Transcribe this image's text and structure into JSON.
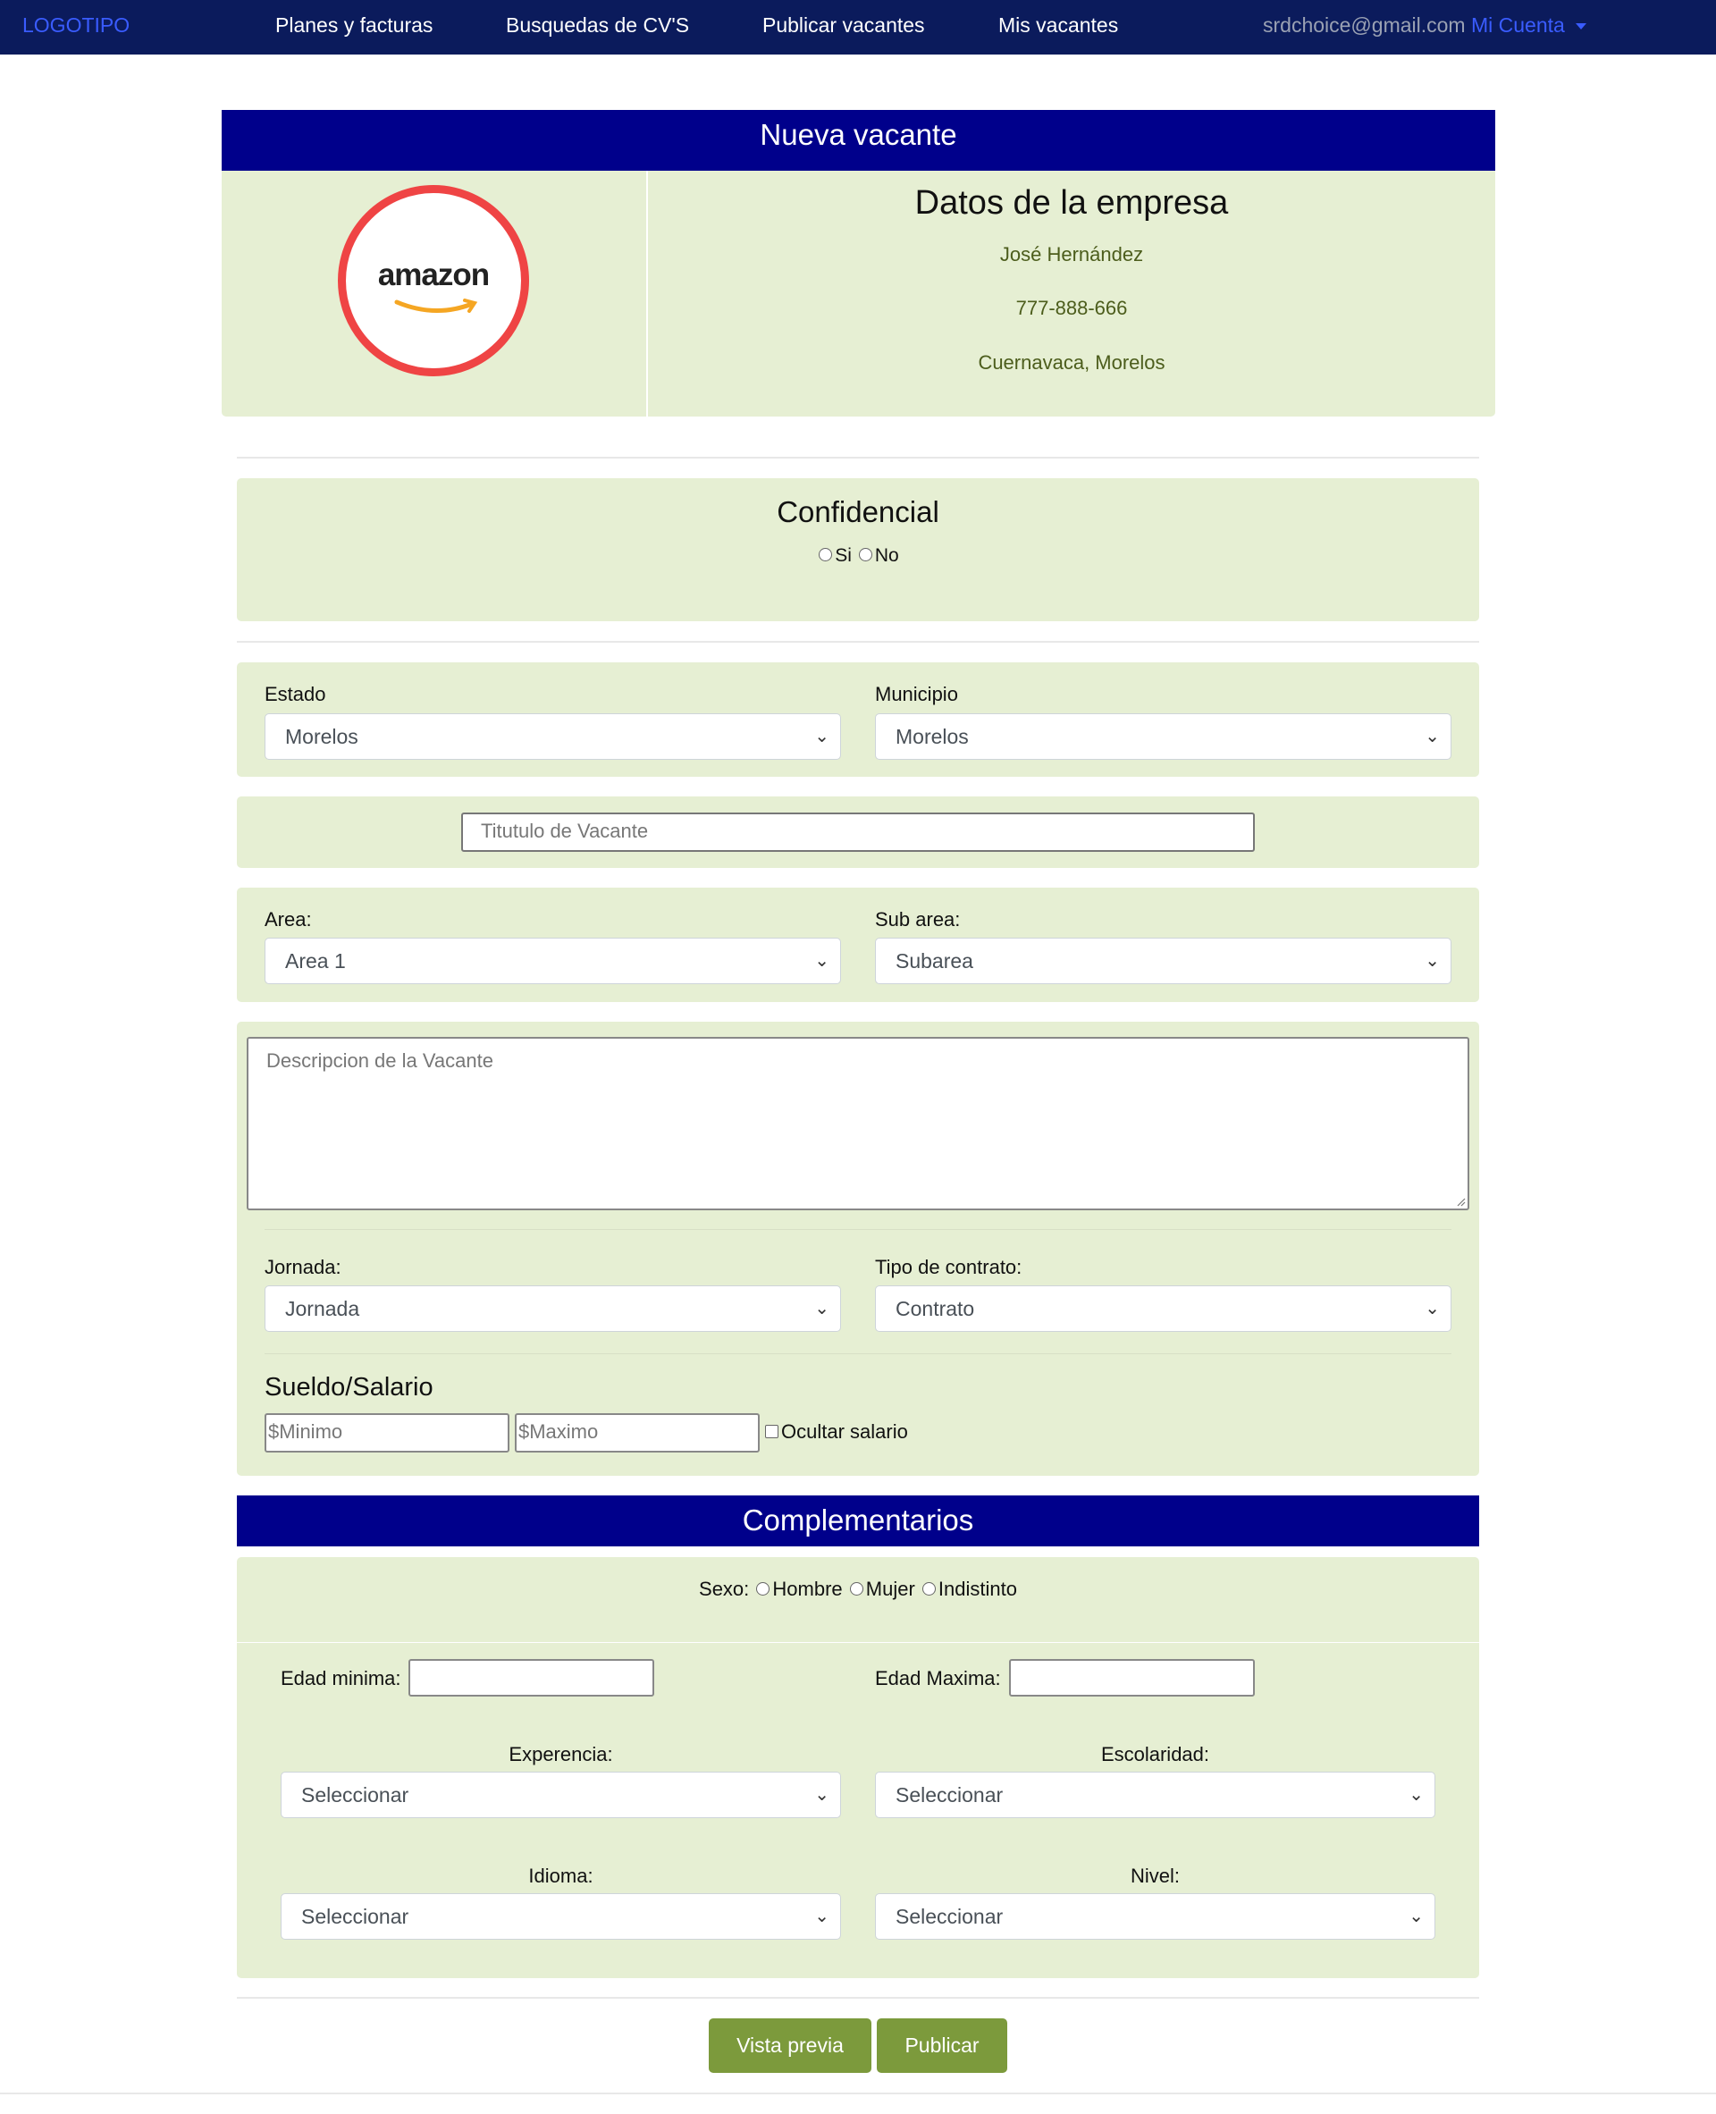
{
  "nav": {
    "logo": "LOGOTIPO",
    "links": [
      "Planes y facturas",
      "Busquedas de CV'S",
      "Publicar vacantes",
      "Mis vacantes"
    ],
    "email": "srdchoice@gmail.com",
    "account": "Mi Cuenta"
  },
  "header": {
    "title": "Nueva vacante"
  },
  "company": {
    "logo_text": "amazon",
    "heading": "Datos de la empresa",
    "name": "José Hernández",
    "phone": "777-888-666",
    "location": "Cuernavaca, Morelos"
  },
  "confidencial": {
    "title": "Confidencial",
    "options": [
      "Si",
      "No"
    ]
  },
  "location": {
    "estado_label": "Estado",
    "estado_value": "Morelos",
    "municipio_label": "Municipio",
    "municipio_value": "Morelos"
  },
  "vacancy_title": {
    "placeholder": "Titutulo de Vacante"
  },
  "area": {
    "area_label": "Area:",
    "area_value": "Area 1",
    "subarea_label": "Sub area:",
    "subarea_value": "Subarea"
  },
  "description": {
    "placeholder": "Descripcion de la Vacante"
  },
  "work": {
    "jornada_label": "Jornada:",
    "jornada_value": "Jornada",
    "contrato_label": "Tipo de contrato:",
    "contrato_value": "Contrato"
  },
  "salary": {
    "title": "Sueldo/Salario",
    "min_placeholder": "$Minimo",
    "max_placeholder": "$Maximo",
    "hide_label": "Ocultar salario"
  },
  "complementarios": {
    "title": "Complementarios",
    "sexo_label": "Sexo:",
    "sexo_options": [
      "Hombre",
      "Mujer",
      "Indistinto"
    ],
    "edad_min_label": "Edad minima:",
    "edad_max_label": "Edad Maxima:",
    "experiencia_label": "Experencia:",
    "experiencia_value": "Seleccionar",
    "escolaridad_label": "Escolaridad:",
    "escolaridad_value": "Seleccionar",
    "idioma_label": "Idioma:",
    "idioma_value": "Seleccionar",
    "nivel_label": "Nivel:",
    "nivel_value": "Seleccionar"
  },
  "actions": {
    "preview": "Vista previa",
    "publish": "Publicar"
  },
  "colors": {
    "nav": "#0b1b5c",
    "header": "#00008b",
    "panel": "#e6efd3",
    "button": "#7c9a3c",
    "logo_ring": "#ef4444"
  }
}
